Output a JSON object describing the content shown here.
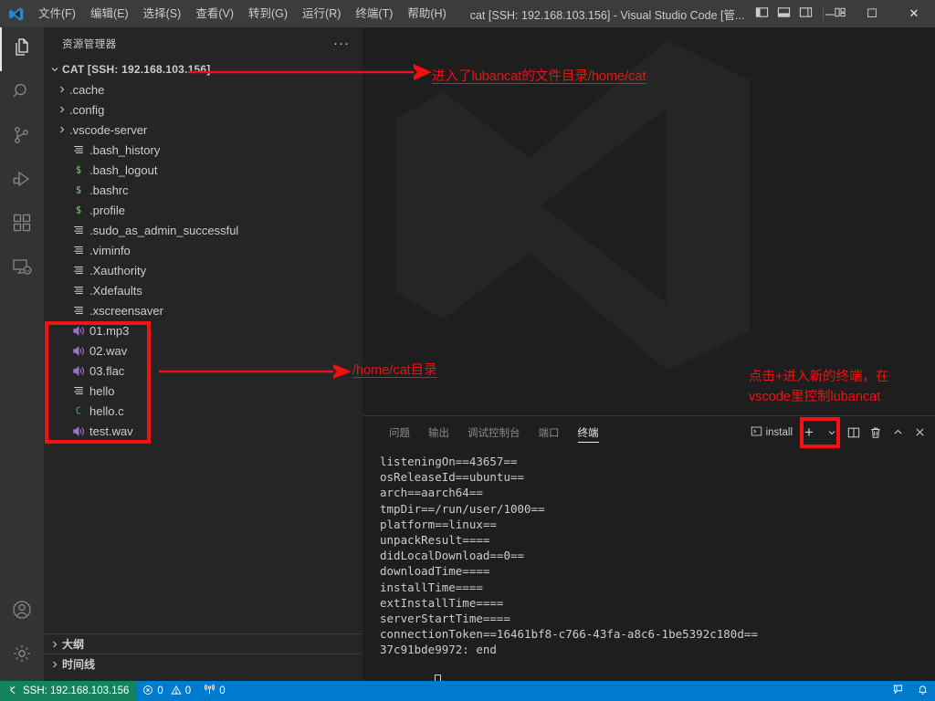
{
  "window": {
    "title": "cat [SSH: 192.168.103.156] - Visual Studio Code [管...",
    "logo_icon": "vscode-logo-icon",
    "minimize_label": "─",
    "maximize_label": "☐",
    "close_label": "✕",
    "layout_icons": [
      "toggle-primary-sidebar-icon",
      "toggle-panel-icon",
      "toggle-secondary-sidebar-icon",
      "customize-layout-icon"
    ]
  },
  "menubar": {
    "items": [
      {
        "label": "文件(F)",
        "name": "menu-file"
      },
      {
        "label": "编辑(E)",
        "name": "menu-edit"
      },
      {
        "label": "选择(S)",
        "name": "menu-selection"
      },
      {
        "label": "查看(V)",
        "name": "menu-view"
      },
      {
        "label": "转到(G)",
        "name": "menu-go"
      },
      {
        "label": "运行(R)",
        "name": "menu-run"
      },
      {
        "label": "终端(T)",
        "name": "menu-terminal"
      },
      {
        "label": "帮助(H)",
        "name": "menu-help"
      }
    ]
  },
  "activitybar": {
    "items": [
      {
        "name": "activity-explorer",
        "icon": "files-icon",
        "active": true
      },
      {
        "name": "activity-search",
        "icon": "search-icon",
        "active": false
      },
      {
        "name": "activity-source-control",
        "icon": "source-control-icon",
        "active": false
      },
      {
        "name": "activity-run-debug",
        "icon": "run-and-debug-icon",
        "active": false
      },
      {
        "name": "activity-extensions",
        "icon": "extensions-icon",
        "active": false
      },
      {
        "name": "activity-remote-explorer",
        "icon": "remote-explorer-icon",
        "active": false
      }
    ],
    "bottom": [
      {
        "name": "activity-accounts",
        "icon": "account-icon"
      },
      {
        "name": "activity-settings",
        "icon": "gear-icon"
      }
    ]
  },
  "sidebar": {
    "header_title": "资源管理器",
    "more_actions": "···",
    "root": {
      "label": "CAT [SSH: 192.168.103.156]",
      "expanded": true,
      "twisty": "chevron-down-icon"
    },
    "files": [
      {
        "label": ".cache",
        "kind": "folder",
        "icon": "chevron-right-icon",
        "fileicon": ""
      },
      {
        "label": ".config",
        "kind": "folder",
        "icon": "chevron-right-icon",
        "fileicon": ""
      },
      {
        "label": ".vscode-server",
        "kind": "folder",
        "icon": "chevron-right-icon",
        "fileicon": ""
      },
      {
        "label": ".bash_history",
        "kind": "file",
        "icon": "",
        "fileicon": "text-file-icon"
      },
      {
        "label": ".bash_logout",
        "kind": "file",
        "icon": "",
        "fileicon": "shell-file-icon"
      },
      {
        "label": ".bashrc",
        "kind": "file",
        "icon": "",
        "fileicon": "shell-file-icon"
      },
      {
        "label": ".profile",
        "kind": "file",
        "icon": "",
        "fileicon": "shell-file-icon"
      },
      {
        "label": ".sudo_as_admin_successful",
        "kind": "file",
        "icon": "",
        "fileicon": "text-file-icon"
      },
      {
        "label": ".viminfo",
        "kind": "file",
        "icon": "",
        "fileicon": "text-file-icon"
      },
      {
        "label": ".Xauthority",
        "kind": "file",
        "icon": "",
        "fileicon": "text-file-icon"
      },
      {
        "label": ".Xdefaults",
        "kind": "file",
        "icon": "",
        "fileicon": "text-file-icon"
      },
      {
        "label": ".xscreensaver",
        "kind": "file",
        "icon": "",
        "fileicon": "text-file-icon"
      },
      {
        "label": "01.mp3",
        "kind": "file",
        "icon": "",
        "fileicon": "audio-file-icon"
      },
      {
        "label": "02.wav",
        "kind": "file",
        "icon": "",
        "fileicon": "audio-file-icon"
      },
      {
        "label": "03.flac",
        "kind": "file",
        "icon": "",
        "fileicon": "audio-file-icon"
      },
      {
        "label": "hello",
        "kind": "file",
        "icon": "",
        "fileicon": "text-file-icon"
      },
      {
        "label": "hello.c",
        "kind": "file",
        "icon": "",
        "fileicon": "c-file-icon"
      },
      {
        "label": "test.wav",
        "kind": "file",
        "icon": "",
        "fileicon": "audio-file-icon"
      }
    ],
    "sections": [
      {
        "label": "大纲",
        "name": "sidebar-section-outline"
      },
      {
        "label": "时间线",
        "name": "sidebar-section-timeline"
      }
    ]
  },
  "editor": {
    "watermark_icon": "vscode-watermark-logo"
  },
  "panel": {
    "tabs": [
      {
        "label": "问题",
        "name": "tab-problems",
        "active": false
      },
      {
        "label": "输出",
        "name": "tab-output",
        "active": false
      },
      {
        "label": "调试控制台",
        "name": "tab-debug-console",
        "active": false
      },
      {
        "label": "端口",
        "name": "tab-ports",
        "active": false
      },
      {
        "label": "终端",
        "name": "tab-terminal",
        "active": true
      }
    ],
    "terminal_selector_label": "install",
    "actions": {
      "new_terminal": "+",
      "new_terminal_dropdown": "chevron-down-icon",
      "split_terminal": "split-editor-icon",
      "kill_terminal": "trash-icon",
      "maximize_panel": "chevron-up-icon",
      "close_panel": "close-icon"
    },
    "terminal_lines": [
      "listeningOn==43657==",
      "osReleaseId==ubuntu==",
      "arch==aarch64==",
      "tmpDir==/run/user/1000==",
      "platform==linux==",
      "unpackResult====",
      "didLocalDownload==0==",
      "downloadTime====",
      "installTime====",
      "extInstallTime====",
      "serverStartTime====",
      "connectionToken==16461bf8-c766-43fa-a8c6-1be5392c180d==",
      "37c91bde9972: end"
    ]
  },
  "statusbar": {
    "remote_label": "SSH: 192.168.103.156",
    "remote_icon": "remote-host-icon",
    "errors_icon": "error-icon",
    "errors": "0",
    "warnings_icon": "warning-icon",
    "warnings": "0",
    "ports_icon": "radio-tower-icon",
    "ports": "0",
    "feedback_icon": "feedback-icon",
    "bell_icon": "bell-icon"
  },
  "annotations": {
    "note_home_dir": "进入了lubancat的文件目录/home/cat",
    "note_cat_dir": "/home/cat目录",
    "note_new_terminal_line1": "点击+进入新的终端，在",
    "note_new_terminal_line2": "vscode里控制lubancat",
    "arrow_icon": "red-arrow-icon",
    "highlight_color": "#f21414"
  }
}
